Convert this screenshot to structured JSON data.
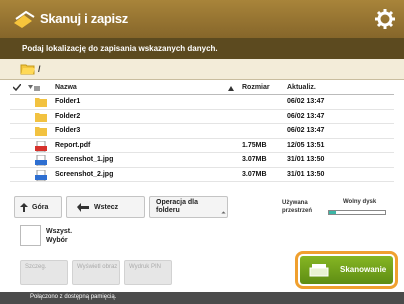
{
  "header": {
    "title": "Skanuj i zapisz"
  },
  "instruction": "Podaj lokalizację do zapisania wskazanych danych.",
  "path": {
    "text": "/"
  },
  "table": {
    "columns": [
      "Nazwa",
      "Rozmiar",
      "Aktualiz."
    ],
    "rows": [
      {
        "name": "Folder1",
        "size": "",
        "date": "06/02 13:47",
        "type": "folder"
      },
      {
        "name": "Folder2",
        "size": "",
        "date": "06/02 13:47",
        "type": "folder"
      },
      {
        "name": "Folder3",
        "size": "",
        "date": "06/02 13:47",
        "type": "folder"
      },
      {
        "name": "Report.pdf",
        "size": "1.75MB",
        "date": "12/05 13:51",
        "type": "pdf"
      },
      {
        "name": "Screenshot_1.jpg",
        "size": "3.07MB",
        "date": "31/01 13:50",
        "type": "image"
      },
      {
        "name": "Screenshot_2.jpg",
        "size": "3.07MB",
        "date": "31/01 13:50",
        "type": "image"
      }
    ]
  },
  "controls": {
    "up": "Góra",
    "back": "Wstecz",
    "folder_ops": "Operacja dla folderu",
    "used_label": "Używana przestrzeń",
    "capacity_label": "Wolny dysk",
    "usage_percent": 12
  },
  "selection": {
    "line1": "Wszyst.",
    "line2": "Wybór"
  },
  "bottom_buttons": [
    "Szczeg.",
    "Wyświetl obraz",
    "Wydruk PIN"
  ],
  "scan_button": "Skanowanie",
  "status": "Połączono z dostępną pamięcią."
}
